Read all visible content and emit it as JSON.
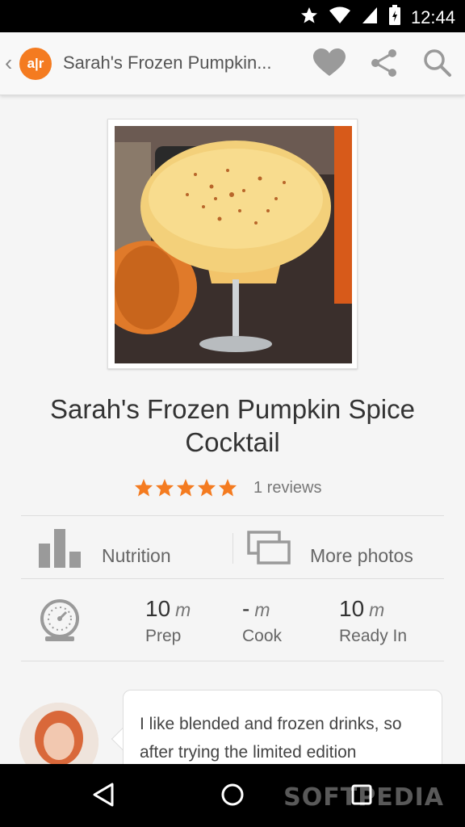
{
  "status_bar": {
    "time": "12:44"
  },
  "app_bar": {
    "logo_text": "a|r",
    "title": "Sarah's Frozen Pumpkin..."
  },
  "recipe": {
    "title": "Sarah's Frozen Pumpkin Spice Cocktail",
    "rating": 5,
    "max_rating": 5,
    "reviews_text": "1 reviews"
  },
  "actions": {
    "nutrition_label": "Nutrition",
    "more_photos_label": "More photos"
  },
  "times": [
    {
      "value": "10",
      "unit": "m",
      "caption": "Prep"
    },
    {
      "value": "-",
      "unit": "m",
      "caption": "Cook"
    },
    {
      "value": "10",
      "unit": "m",
      "caption": "Ready In"
    }
  ],
  "review": {
    "text": "I like blended and frozen drinks, so after trying the limited edition"
  },
  "watermark": "SOFTPEDIA",
  "colors": {
    "brand_orange": "#f47b20",
    "status_bar": "#000000",
    "nav_bar": "#000000"
  },
  "icons": [
    "star-icon",
    "wifi-icon",
    "signal-icon",
    "battery-icon",
    "back-chevron-icon",
    "heart-icon",
    "share-icon",
    "search-icon",
    "nutrition-chart-icon",
    "photos-icon",
    "timer-icon",
    "nav-back-icon",
    "nav-home-icon",
    "nav-recents-icon"
  ]
}
